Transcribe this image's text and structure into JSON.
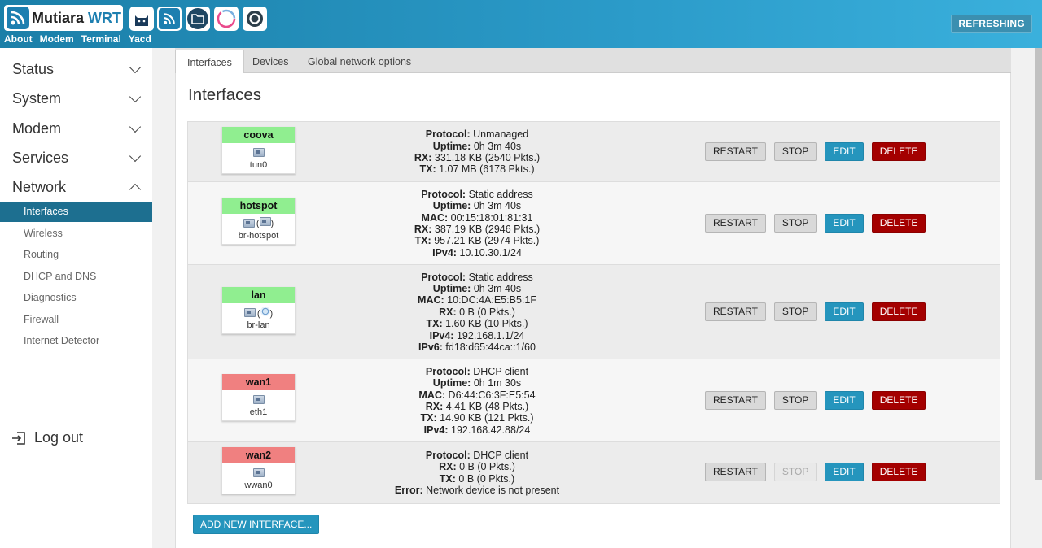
{
  "header": {
    "brand": {
      "name": "Mutiara",
      "suffix": "WRT"
    },
    "icons": [
      "cat-icon",
      "wifi-feed-icon",
      "folder-icon",
      "speedtest-icon",
      "settings-icon"
    ],
    "nav": [
      "About",
      "Modem",
      "Terminal",
      "Yacd"
    ],
    "status": "REFRESHING"
  },
  "sidebar": {
    "menus": [
      {
        "label": "Status",
        "expanded": false
      },
      {
        "label": "System",
        "expanded": false
      },
      {
        "label": "Modem",
        "expanded": false
      },
      {
        "label": "Services",
        "expanded": false
      },
      {
        "label": "Network",
        "expanded": true
      }
    ],
    "submenu": [
      "Interfaces",
      "Wireless",
      "Routing",
      "DHCP and DNS",
      "Diagnostics",
      "Firewall",
      "Internet Detector"
    ],
    "active": "Interfaces",
    "logout": "Log out"
  },
  "tabs": [
    "Interfaces",
    "Devices",
    "Global network options"
  ],
  "page_title": "Interfaces",
  "buttons": {
    "restart": "RESTART",
    "stop": "STOP",
    "edit": "EDIT",
    "delete": "DELETE",
    "add": "ADD NEW INTERFACE..."
  },
  "interfaces": [
    {
      "name": "coova",
      "color": "#90ee90",
      "device": "tun0",
      "icons": [
        "device"
      ],
      "lines": [
        {
          "k": "Protocol:",
          "v": "Unmanaged"
        },
        {
          "k": "Uptime:",
          "v": "0h 3m 40s"
        },
        {
          "k": "RX:",
          "v": "331.18 KB (2540 Pkts.)"
        },
        {
          "k": "TX:",
          "v": "1.07 MB (6178 Pkts.)"
        }
      ]
    },
    {
      "name": "hotspot",
      "color": "#90ee90",
      "device": "br-hotspot",
      "icons": [
        "bridge",
        "device-paren"
      ],
      "lines": [
        {
          "k": "Protocol:",
          "v": "Static address"
        },
        {
          "k": "Uptime:",
          "v": "0h 3m 40s"
        },
        {
          "k": "MAC:",
          "v": "00:15:18:01:81:31"
        },
        {
          "k": "RX:",
          "v": "387.19 KB (2946 Pkts.)"
        },
        {
          "k": "TX:",
          "v": "957.21 KB (2974 Pkts.)"
        },
        {
          "k": "IPv4:",
          "v": "10.10.30.1/24"
        }
      ]
    },
    {
      "name": "lan",
      "color": "#90ee90",
      "device": "br-lan",
      "icons": [
        "bridge",
        "wifi-paren"
      ],
      "lines": [
        {
          "k": "Protocol:",
          "v": "Static address"
        },
        {
          "k": "Uptime:",
          "v": "0h 3m 40s"
        },
        {
          "k": "MAC:",
          "v": "10:DC:4A:E5:B5:1F"
        },
        {
          "k": "RX:",
          "v": "0 B (0 Pkts.)"
        },
        {
          "k": "TX:",
          "v": "1.60 KB (10 Pkts.)"
        },
        {
          "k": "IPv4:",
          "v": "192.168.1.1/24"
        },
        {
          "k": "IPv6:",
          "v": "fd18:d65:44ca::1/60"
        }
      ]
    },
    {
      "name": "wan1",
      "color": "#f08080",
      "device": "eth1",
      "icons": [
        "device"
      ],
      "lines": [
        {
          "k": "Protocol:",
          "v": "DHCP client"
        },
        {
          "k": "Uptime:",
          "v": "0h 1m 30s"
        },
        {
          "k": "MAC:",
          "v": "D6:44:C6:3F:E5:54"
        },
        {
          "k": "RX:",
          "v": "4.41 KB (48 Pkts.)"
        },
        {
          "k": "TX:",
          "v": "14.90 KB (121 Pkts.)"
        },
        {
          "k": "IPv4:",
          "v": "192.168.42.88/24"
        }
      ]
    },
    {
      "name": "wan2",
      "color": "#f08080",
      "device": "wwan0",
      "icons": [
        "device"
      ],
      "stop_disabled": true,
      "lines": [
        {
          "k": "Protocol:",
          "v": "DHCP client"
        },
        {
          "k": "RX:",
          "v": "0 B (0 Pkts.)"
        },
        {
          "k": "TX:",
          "v": "0 B (0 Pkts.)"
        },
        {
          "k": "Error:",
          "v": "Network device is not present"
        }
      ]
    }
  ]
}
